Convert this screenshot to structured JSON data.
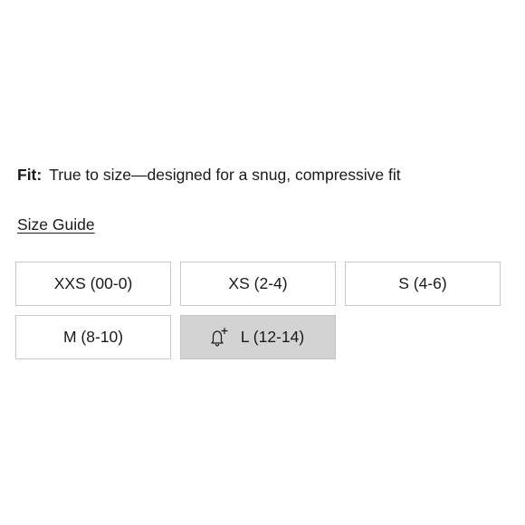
{
  "fit": {
    "label": "Fit:",
    "description": "True to size—designed for a snug, compressive fit"
  },
  "size_guide": {
    "label": "Size Guide"
  },
  "sizes": [
    {
      "label": "XXS (00-0)",
      "available": true
    },
    {
      "label": "XS (2-4)",
      "available": true
    },
    {
      "label": "S (4-6)",
      "available": true
    },
    {
      "label": "M (8-10)",
      "available": true
    },
    {
      "label": "L (12-14)",
      "available": false,
      "icon": "bell-plus-icon"
    }
  ],
  "colors": {
    "text": "#1a1a1a",
    "border": "#c8c8c8",
    "unavailable_bg": "#d3d3d3"
  }
}
